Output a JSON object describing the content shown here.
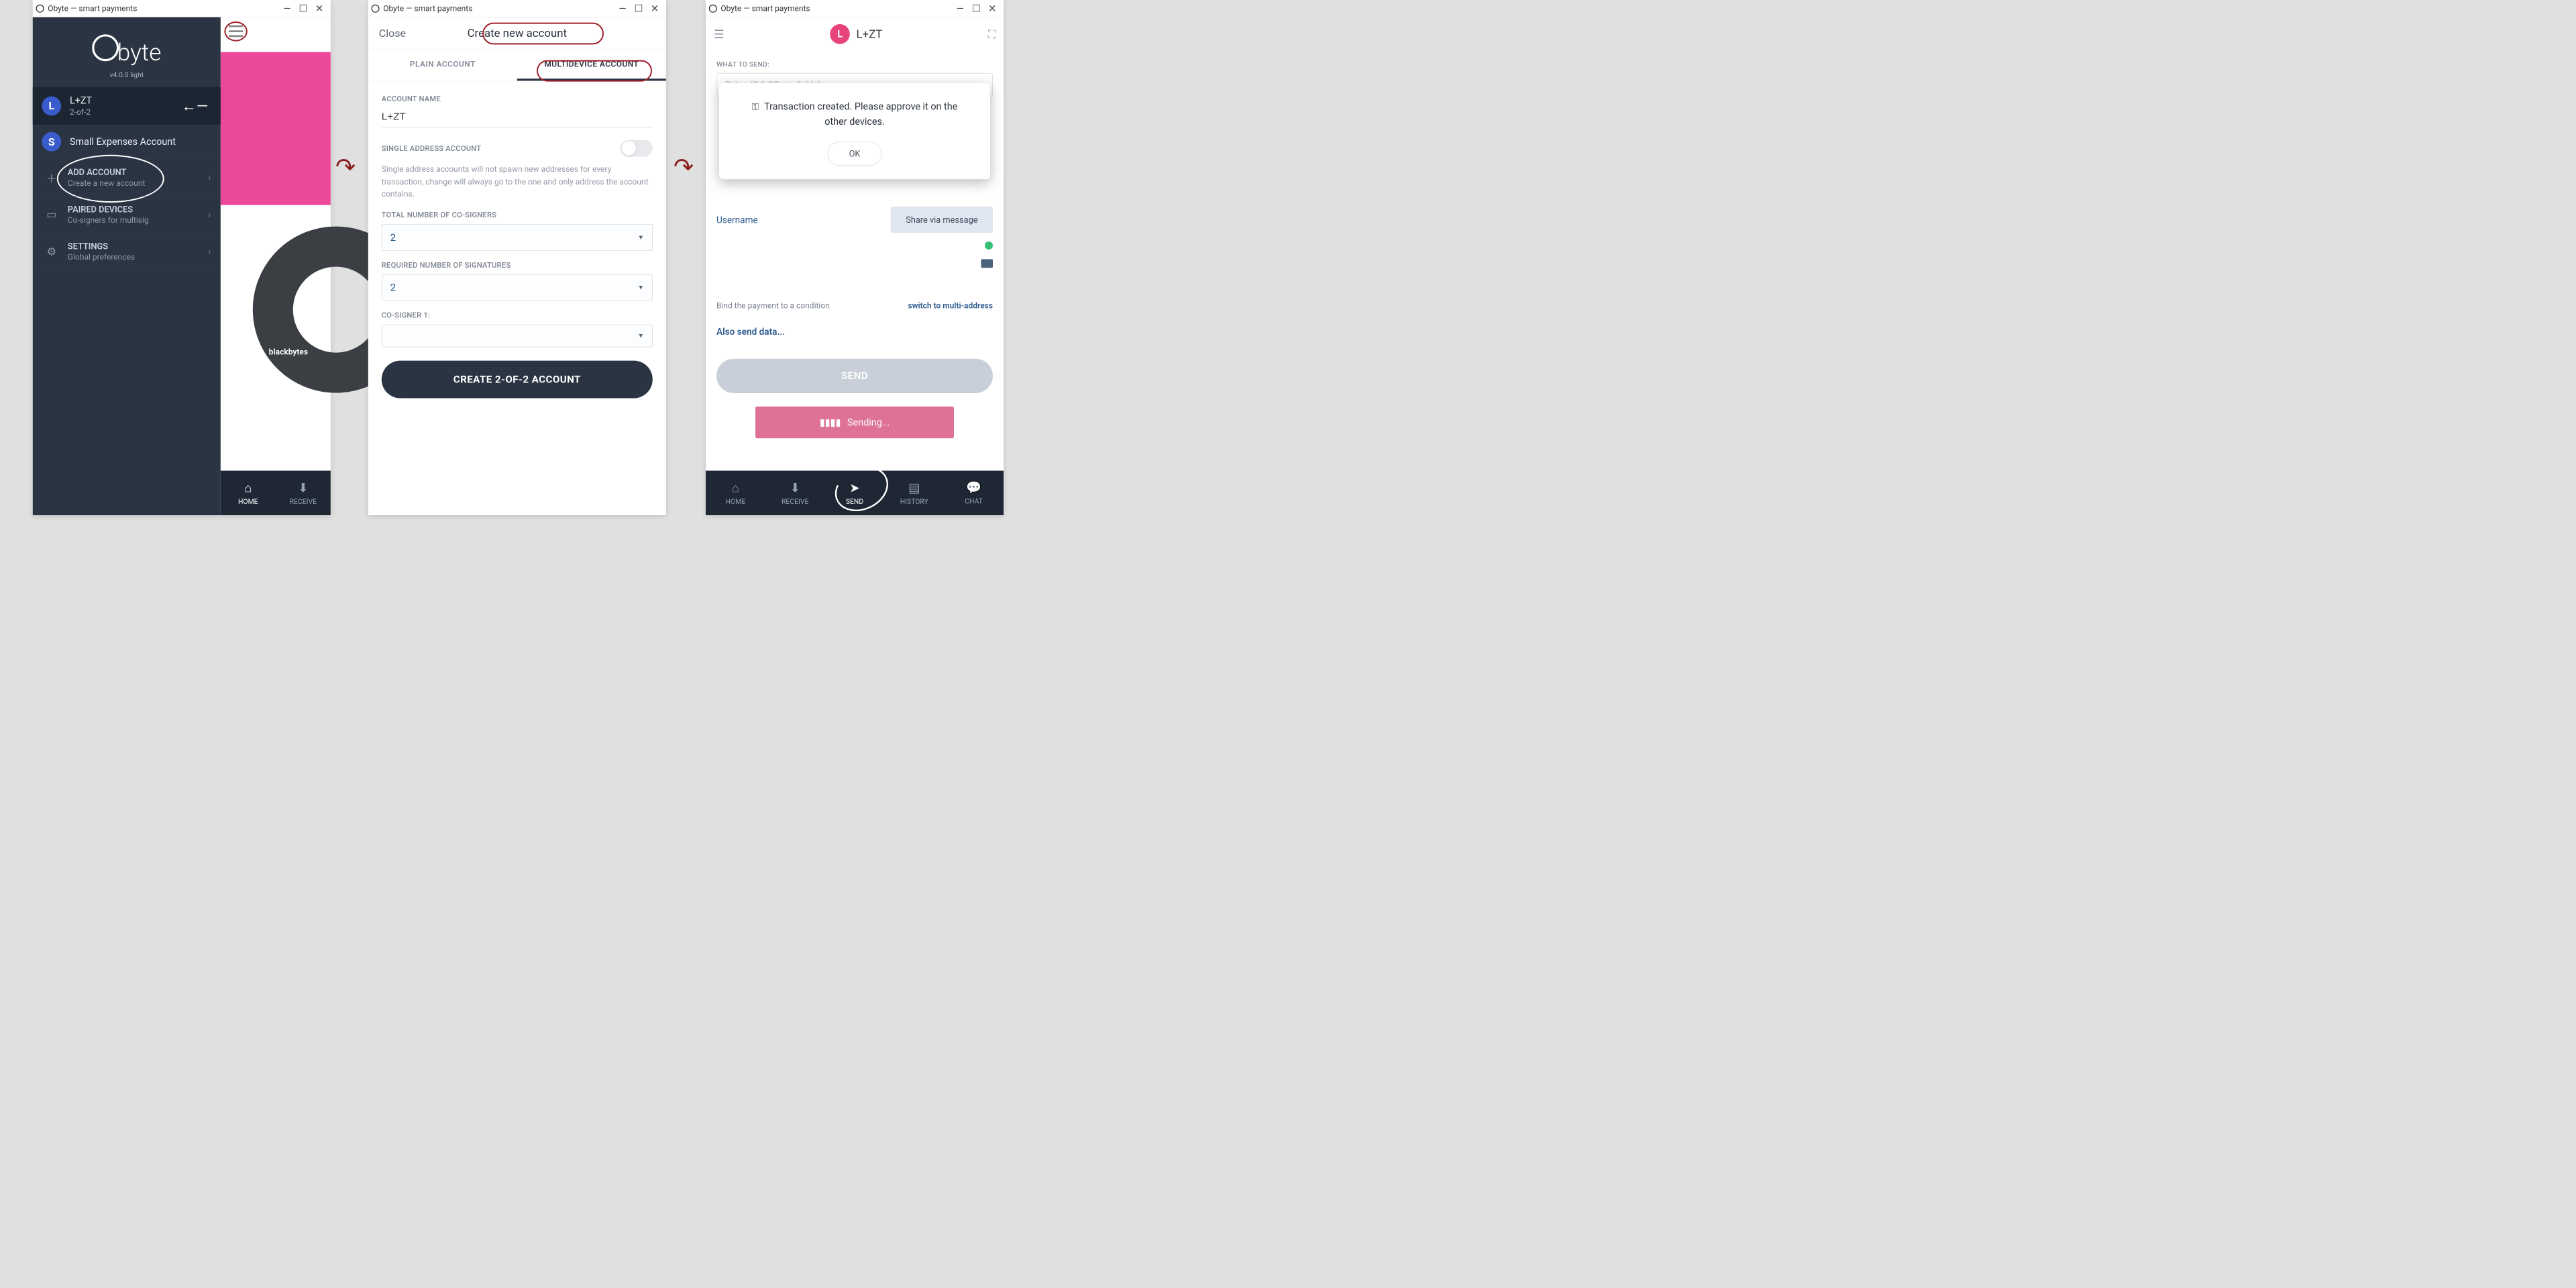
{
  "window_title": "Obyte — smart payments",
  "panel1": {
    "logo_text": "byte",
    "version": "v4.0.0 light",
    "accounts": [
      {
        "badge": "L",
        "name": "L+ZT",
        "sub": "2-of-2"
      },
      {
        "badge": "S",
        "name": "Small Expenses Account",
        "sub": ""
      }
    ],
    "menu": {
      "add_account": {
        "label": "ADD ACCOUNT",
        "sub": "Create a new account"
      },
      "paired": {
        "label": "PAIRED DEVICES",
        "sub": "Co-signers for multisig"
      },
      "settings": {
        "label": "SETTINGS",
        "sub": "Global preferences"
      }
    },
    "donut_label": "blackbytes",
    "nav": {
      "home": "HOME",
      "receive": "RECEIVE"
    }
  },
  "panel2": {
    "close": "Close",
    "title": "Create new account",
    "tabs": {
      "plain": "PLAIN ACCOUNT",
      "multi": "MULTIDEVICE ACCOUNT"
    },
    "form": {
      "account_name_label": "ACCOUNT NAME",
      "account_name_value": "L+ZT",
      "single_addr_label": "SINGLE ADDRESS ACCOUNT",
      "single_addr_help": "Single address accounts will not spawn new addresses for every transaction, change will always go to the one and only address the account contains.",
      "cosigners_label": "TOTAL NUMBER OF CO-SIGNERS",
      "cosigners_value": "2",
      "signatures_label": "REQUIRED NUMBER OF SIGNATURES",
      "signatures_value": "2",
      "cosigner1_label": "CO-SIGNER 1:",
      "submit": "CREATE 2-OF-2 ACCOUNT"
    }
  },
  "panel3": {
    "account_badge": "L",
    "account_name": "L+ZT",
    "what_to_send": "WHAT TO SEND:",
    "asset_peek": "Bytes (0.1 GB available)",
    "username": "Username",
    "share": "Share via message",
    "bind_text": "Bind the payment to a condition",
    "switch_text": "switch to multi-address",
    "also_send": "Also send data...",
    "send_btn": "SEND",
    "sending": "Sending...",
    "alert": {
      "text": "Transaction created. Please approve it on the other devices.",
      "ok": "OK"
    },
    "nav": {
      "home": "HOME",
      "receive": "RECEIVE",
      "send": "SEND",
      "history": "HISTORY",
      "chat": "CHAT"
    }
  }
}
